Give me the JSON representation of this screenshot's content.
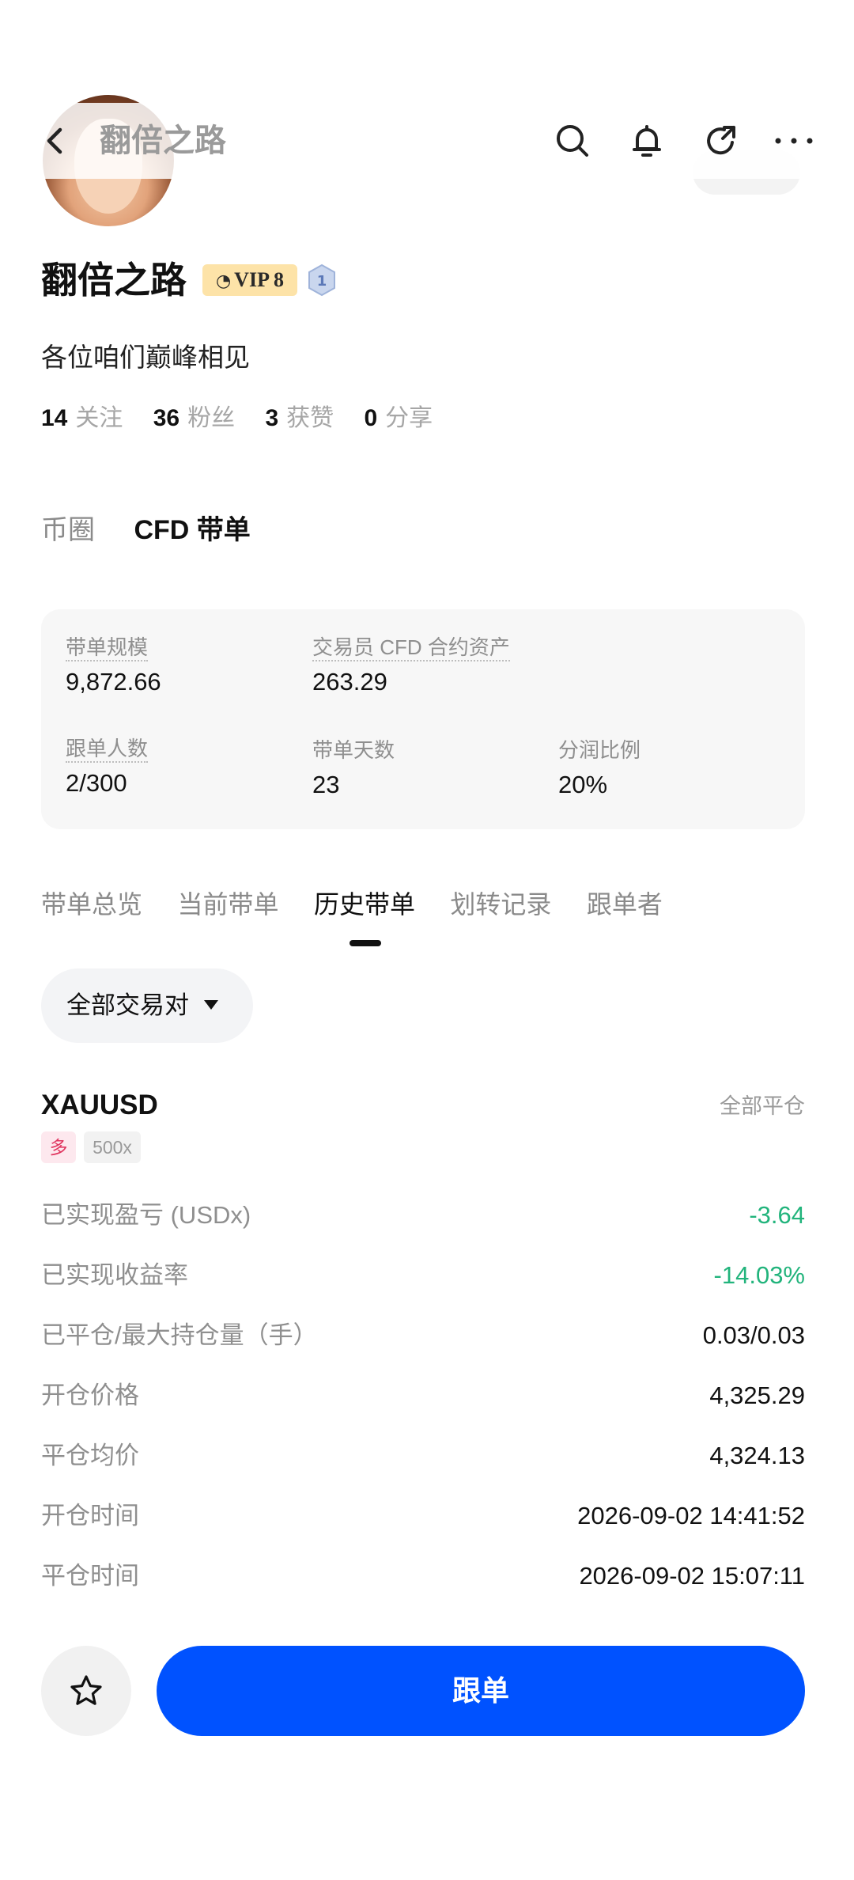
{
  "header": {
    "title": "翻倍之路",
    "icons": [
      "back-arrow-icon",
      "search-icon",
      "bell-icon",
      "share-icon",
      "more-icon"
    ]
  },
  "profile": {
    "name": "翻倍之路",
    "vip_label": "VIP 8",
    "level": "1",
    "bio": "各位咱们巅峰相见",
    "stats": [
      {
        "num": "14",
        "label": "关注"
      },
      {
        "num": "36",
        "label": "粉丝"
      },
      {
        "num": "3",
        "label": "获赞"
      },
      {
        "num": "0",
        "label": "分享"
      }
    ]
  },
  "category_tabs": [
    {
      "label": "币圈",
      "active": false
    },
    {
      "label": "CFD 带单",
      "active": true
    }
  ],
  "stats_card": {
    "scale_label": "带单规模",
    "scale_value": "9,872.66",
    "assets_label": "交易员 CFD 合约资产",
    "assets_value": "263.29",
    "followers_label": "跟单人数",
    "followers_value": "2/300",
    "days_label": "带单天数",
    "days_value": "23",
    "share_label": "分润比例",
    "share_value": "20%"
  },
  "sub_tabs": [
    {
      "label": "带单总览",
      "active": false
    },
    {
      "label": "当前带单",
      "active": false
    },
    {
      "label": "历史带单",
      "active": true
    },
    {
      "label": "划转记录",
      "active": false
    },
    {
      "label": "跟单者",
      "active": false
    }
  ],
  "filter": {
    "label": "全部交易对"
  },
  "position": {
    "symbol": "XAUUSD",
    "status": "全部平仓",
    "direction": "多",
    "leverage": "500x",
    "rows": [
      {
        "label": "已实现盈亏 (USDx)",
        "value": "-3.64",
        "tone": "green"
      },
      {
        "label": "已实现收益率",
        "value": "-14.03%",
        "tone": "green"
      },
      {
        "label": "已平仓/最大持仓量（手）",
        "value": "0.03/0.03",
        "tone": "normal"
      },
      {
        "label": "开仓价格",
        "value": "4,325.29",
        "tone": "normal"
      },
      {
        "label": "平仓均价",
        "value": "4,324.13",
        "tone": "normal"
      },
      {
        "label": "开仓时间",
        "value": "2026-09-02 14:41:52",
        "tone": "normal"
      },
      {
        "label": "平仓时间",
        "value": "2026-09-02 15:07:11",
        "tone": "normal"
      }
    ]
  },
  "bottom": {
    "follow_label": "跟单",
    "favorite_icon": "star-icon"
  },
  "colors": {
    "primary": "#0052ff",
    "profit_green": "#22b47c",
    "long_red": "#e0355f",
    "vip_gold": "#fde3a8"
  }
}
